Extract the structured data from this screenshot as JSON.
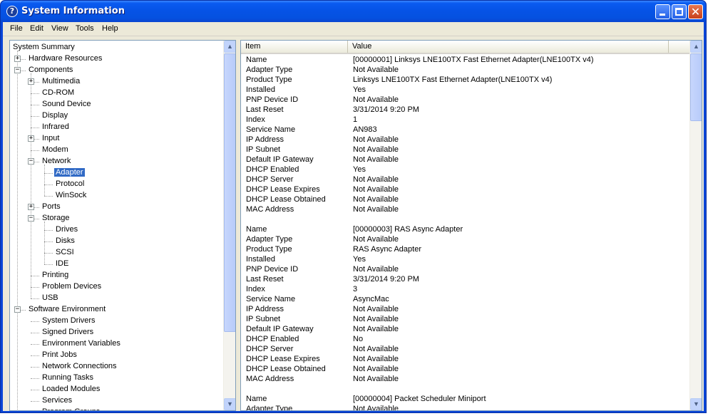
{
  "window": {
    "title": "System Information"
  },
  "menubar": {
    "items": [
      "File",
      "Edit",
      "View",
      "Tools",
      "Help"
    ]
  },
  "tree": {
    "items": [
      {
        "label": "System Summary",
        "level": 0,
        "expander": null
      },
      {
        "label": "Hardware Resources",
        "level": 1,
        "expander": "+"
      },
      {
        "label": "Components",
        "level": 1,
        "expander": "-"
      },
      {
        "label": "Multimedia",
        "level": 2,
        "expander": "+"
      },
      {
        "label": "CD-ROM",
        "level": 2,
        "expander": null
      },
      {
        "label": "Sound Device",
        "level": 2,
        "expander": null
      },
      {
        "label": "Display",
        "level": 2,
        "expander": null
      },
      {
        "label": "Infrared",
        "level": 2,
        "expander": null
      },
      {
        "label": "Input",
        "level": 2,
        "expander": "+"
      },
      {
        "label": "Modem",
        "level": 2,
        "expander": null
      },
      {
        "label": "Network",
        "level": 2,
        "expander": "-"
      },
      {
        "label": "Adapter",
        "level": 3,
        "expander": null,
        "selected": true
      },
      {
        "label": "Protocol",
        "level": 3,
        "expander": null
      },
      {
        "label": "WinSock",
        "level": 3,
        "expander": null
      },
      {
        "label": "Ports",
        "level": 2,
        "expander": "+"
      },
      {
        "label": "Storage",
        "level": 2,
        "expander": "-"
      },
      {
        "label": "Drives",
        "level": 3,
        "expander": null
      },
      {
        "label": "Disks",
        "level": 3,
        "expander": null
      },
      {
        "label": "SCSI",
        "level": 3,
        "expander": null
      },
      {
        "label": "IDE",
        "level": 3,
        "expander": null
      },
      {
        "label": "Printing",
        "level": 2,
        "expander": null
      },
      {
        "label": "Problem Devices",
        "level": 2,
        "expander": null
      },
      {
        "label": "USB",
        "level": 2,
        "expander": null
      },
      {
        "label": "Software Environment",
        "level": 1,
        "expander": "-"
      },
      {
        "label": "System Drivers",
        "level": 2,
        "expander": null
      },
      {
        "label": "Signed Drivers",
        "level": 2,
        "expander": null
      },
      {
        "label": "Environment Variables",
        "level": 2,
        "expander": null
      },
      {
        "label": "Print Jobs",
        "level": 2,
        "expander": null
      },
      {
        "label": "Network Connections",
        "level": 2,
        "expander": null
      },
      {
        "label": "Running Tasks",
        "level": 2,
        "expander": null
      },
      {
        "label": "Loaded Modules",
        "level": 2,
        "expander": null
      },
      {
        "label": "Services",
        "level": 2,
        "expander": null
      },
      {
        "label": "Program Groups",
        "level": 2,
        "expander": null
      }
    ]
  },
  "details": {
    "columns": [
      "Item",
      "Value"
    ],
    "rows": [
      [
        "Name",
        "[00000001] Linksys LNE100TX Fast Ethernet Adapter(LNE100TX v4)"
      ],
      [
        "Adapter Type",
        "Not Available"
      ],
      [
        "Product Type",
        "Linksys LNE100TX Fast Ethernet Adapter(LNE100TX v4)"
      ],
      [
        "Installed",
        "Yes"
      ],
      [
        "PNP Device ID",
        "Not Available"
      ],
      [
        "Last Reset",
        "3/31/2014 9:20 PM"
      ],
      [
        "Index",
        "1"
      ],
      [
        "Service Name",
        "AN983"
      ],
      [
        "IP Address",
        "Not Available"
      ],
      [
        "IP Subnet",
        "Not Available"
      ],
      [
        "Default IP Gateway",
        "Not Available"
      ],
      [
        "DHCP Enabled",
        "Yes"
      ],
      [
        "DHCP Server",
        "Not Available"
      ],
      [
        "DHCP Lease Expires",
        "Not Available"
      ],
      [
        "DHCP Lease Obtained",
        "Not Available"
      ],
      [
        "MAC Address",
        "Not Available"
      ],
      [
        "",
        ""
      ],
      [
        "Name",
        "[00000003] RAS Async Adapter"
      ],
      [
        "Adapter Type",
        "Not Available"
      ],
      [
        "Product Type",
        "RAS Async Adapter"
      ],
      [
        "Installed",
        "Yes"
      ],
      [
        "PNP Device ID",
        "Not Available"
      ],
      [
        "Last Reset",
        "3/31/2014 9:20 PM"
      ],
      [
        "Index",
        "3"
      ],
      [
        "Service Name",
        "AsyncMac"
      ],
      [
        "IP Address",
        "Not Available"
      ],
      [
        "IP Subnet",
        "Not Available"
      ],
      [
        "Default IP Gateway",
        "Not Available"
      ],
      [
        "DHCP Enabled",
        "No"
      ],
      [
        "DHCP Server",
        "Not Available"
      ],
      [
        "DHCP Lease Expires",
        "Not Available"
      ],
      [
        "DHCP Lease Obtained",
        "Not Available"
      ],
      [
        "MAC Address",
        "Not Available"
      ],
      [
        "",
        ""
      ],
      [
        "Name",
        "[00000004] Packet Scheduler Miniport"
      ],
      [
        "Adapter Type",
        "Not Available"
      ]
    ]
  },
  "icons": {
    "app": "help-circle-icon",
    "minimize": "minimize-icon",
    "maximize": "maximize-icon",
    "close": "close-icon"
  },
  "colors": {
    "titlebar": "#0653e6",
    "selection": "#316ac5",
    "face": "#ece9d8"
  }
}
